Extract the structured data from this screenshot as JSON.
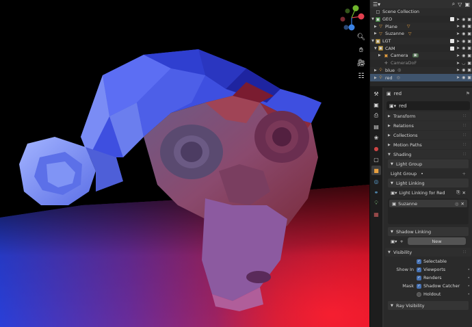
{
  "outliner": {
    "title": "Scene Collection",
    "rows": [
      {
        "name": "GEO",
        "kind": "collection",
        "icon_color": "#e3e3e3"
      },
      {
        "name": "Plane",
        "kind": "mesh",
        "icon_color": "#e8a040"
      },
      {
        "name": "Suzanne",
        "kind": "mesh",
        "icon_color": "#e8a040"
      },
      {
        "name": "LGT",
        "kind": "collection",
        "icon_color": "#e3e3e3"
      },
      {
        "name": "CAM",
        "kind": "collection",
        "icon_color": "#e3e3e3"
      },
      {
        "name": "Camera",
        "kind": "camera",
        "icon_color": "#e8a040"
      },
      {
        "name": "CameraDoF",
        "kind": "empty",
        "icon_color": "#aaaaaa"
      },
      {
        "name": "blue",
        "kind": "light",
        "icon_color": "#e8a040"
      },
      {
        "name": "red",
        "kind": "light",
        "icon_color": "#e8a040"
      }
    ]
  },
  "properties": {
    "object_name": "red",
    "datablock_name": "red",
    "panels": {
      "transform": "Transform",
      "relations": "Relations",
      "collections": "Collections",
      "motion_paths": "Motion Paths",
      "shading": "Shading",
      "light_group": "Light Group",
      "light_group_label": "Light Group",
      "light_linking": "Light Linking",
      "light_linking_for": "Light Linking for Red",
      "linked_item": "Suzanne",
      "shadow_linking": "Shadow Linking",
      "new_button": "New",
      "visibility": "Visibility",
      "selectable": "Selectable",
      "show_in": "Show In",
      "viewports": "Viewports",
      "renders": "Renders",
      "mask": "Mask",
      "shadow_catcher": "Shadow Catcher",
      "holdout": "Holdout",
      "ray_visibility": "Ray Visibility"
    }
  },
  "gizmo": {
    "x_color": "#e2404f",
    "y_color": "#6fb52c",
    "z_color": "#3b83e6"
  },
  "colors": {
    "selected_row": "#3f546d",
    "accent": "#4772b3"
  }
}
